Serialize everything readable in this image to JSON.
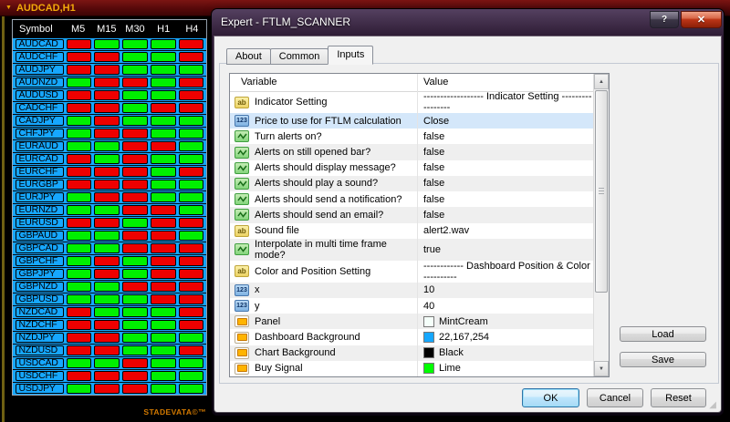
{
  "icons": {
    "dropdown": "▼",
    "help": "?",
    "close": "✕",
    "scroll_up": "▲",
    "scroll_down": "▼",
    "resize_grip": "◢"
  },
  "chart_window": {
    "title": "AUDCAD,H1",
    "watermark": "STADEVATA©™",
    "dashboard": {
      "columns": [
        "Symbol",
        "M5",
        "M15",
        "M30",
        "H1",
        "H4"
      ],
      "panel_color": "#16A7FE",
      "buy_color": "#00F000",
      "sell_color": "#EE0000",
      "rows": [
        {
          "symbol": "AUDCAD",
          "signals": [
            "sell",
            "buy",
            "buy",
            "buy",
            "sell"
          ]
        },
        {
          "symbol": "AUDCHF",
          "signals": [
            "sell",
            "sell",
            "buy",
            "buy",
            "sell"
          ]
        },
        {
          "symbol": "AUDJPY",
          "signals": [
            "sell",
            "sell",
            "buy",
            "buy",
            "buy"
          ]
        },
        {
          "symbol": "AUDNZD",
          "signals": [
            "buy",
            "sell",
            "sell",
            "buy",
            "sell"
          ]
        },
        {
          "symbol": "AUDUSD",
          "signals": [
            "sell",
            "sell",
            "buy",
            "buy",
            "sell"
          ]
        },
        {
          "symbol": "CADCHF",
          "signals": [
            "sell",
            "sell",
            "buy",
            "sell",
            "sell"
          ]
        },
        {
          "symbol": "CADJPY",
          "signals": [
            "buy",
            "sell",
            "buy",
            "buy",
            "buy"
          ]
        },
        {
          "symbol": "CHFJPY",
          "signals": [
            "buy",
            "sell",
            "sell",
            "buy",
            "buy"
          ]
        },
        {
          "symbol": "EURAUD",
          "signals": [
            "buy",
            "buy",
            "sell",
            "sell",
            "buy"
          ]
        },
        {
          "symbol": "EURCAD",
          "signals": [
            "sell",
            "buy",
            "sell",
            "buy",
            "buy"
          ]
        },
        {
          "symbol": "EURCHF",
          "signals": [
            "sell",
            "sell",
            "sell",
            "buy",
            "sell"
          ]
        },
        {
          "symbol": "EURGBP",
          "signals": [
            "sell",
            "sell",
            "sell",
            "buy",
            "buy"
          ]
        },
        {
          "symbol": "EURJPY",
          "signals": [
            "buy",
            "sell",
            "sell",
            "buy",
            "buy"
          ]
        },
        {
          "symbol": "EURNZD",
          "signals": [
            "buy",
            "buy",
            "sell",
            "sell",
            "buy"
          ]
        },
        {
          "symbol": "EURUSD",
          "signals": [
            "sell",
            "sell",
            "buy",
            "sell",
            "sell"
          ]
        },
        {
          "symbol": "GBPAUD",
          "signals": [
            "buy",
            "buy",
            "sell",
            "sell",
            "buy"
          ]
        },
        {
          "symbol": "GBPCAD",
          "signals": [
            "buy",
            "buy",
            "sell",
            "sell",
            "sell"
          ]
        },
        {
          "symbol": "GBPCHF",
          "signals": [
            "buy",
            "sell",
            "buy",
            "sell",
            "sell"
          ]
        },
        {
          "symbol": "GBPJPY",
          "signals": [
            "buy",
            "sell",
            "buy",
            "sell",
            "sell"
          ]
        },
        {
          "symbol": "GBPNZD",
          "signals": [
            "buy",
            "buy",
            "sell",
            "sell",
            "sell"
          ]
        },
        {
          "symbol": "GBPUSD",
          "signals": [
            "buy",
            "buy",
            "buy",
            "sell",
            "sell"
          ]
        },
        {
          "symbol": "NZDCAD",
          "signals": [
            "sell",
            "buy",
            "buy",
            "buy",
            "sell"
          ]
        },
        {
          "symbol": "NZDCHF",
          "signals": [
            "sell",
            "sell",
            "buy",
            "buy",
            "sell"
          ]
        },
        {
          "symbol": "NZDJPY",
          "signals": [
            "sell",
            "sell",
            "buy",
            "buy",
            "buy"
          ]
        },
        {
          "symbol": "NZDUSD",
          "signals": [
            "sell",
            "sell",
            "buy",
            "buy",
            "sell"
          ]
        },
        {
          "symbol": "USDCAD",
          "signals": [
            "buy",
            "buy",
            "sell",
            "buy",
            "buy"
          ]
        },
        {
          "symbol": "USDCHF",
          "signals": [
            "sell",
            "sell",
            "sell",
            "buy",
            "buy"
          ]
        },
        {
          "symbol": "USDJPY",
          "signals": [
            "buy",
            "sell",
            "sell",
            "buy",
            "buy"
          ]
        }
      ]
    }
  },
  "dialog": {
    "title": "Expert - FTLM_SCANNER",
    "tabs": [
      {
        "label": "About",
        "active": false
      },
      {
        "label": "Common",
        "active": false
      },
      {
        "label": "Inputs",
        "active": true
      }
    ],
    "table": {
      "headers": [
        "Variable",
        "Value"
      ],
      "type_labels": {
        "string": "ab",
        "integer": "123",
        "bool": "",
        "color": ""
      },
      "rows": [
        {
          "type": "string",
          "name": "Indicator Setting",
          "value": "------------------ Indicator Setting -----------------"
        },
        {
          "type": "integer",
          "name": "Price to use for FTLM calculation",
          "value": "Close",
          "selected": true
        },
        {
          "type": "bool",
          "name": "Turn alerts on?",
          "value": "false"
        },
        {
          "type": "bool",
          "name": "Alerts on still opened bar?",
          "value": "false"
        },
        {
          "type": "bool",
          "name": "Alerts should display message?",
          "value": "false"
        },
        {
          "type": "bool",
          "name": "Alerts should play a sound?",
          "value": "false"
        },
        {
          "type": "bool",
          "name": "Alerts should send a notification?",
          "value": "false"
        },
        {
          "type": "bool",
          "name": "Alerts should send an email?",
          "value": "false"
        },
        {
          "type": "string",
          "name": "Sound file",
          "value": "alert2.wav"
        },
        {
          "type": "bool",
          "name": "Interpolate in multi time frame mode?",
          "value": "true"
        },
        {
          "type": "string",
          "name": "Color and Position Setting",
          "value": "------------ Dashboard Position & Color ----------"
        },
        {
          "type": "integer",
          "name": "x",
          "value": "10"
        },
        {
          "type": "integer",
          "name": "y",
          "value": "40"
        },
        {
          "type": "color",
          "name": "Panel",
          "value": "MintCream",
          "swatch": "#F5FFFA"
        },
        {
          "type": "color",
          "name": "Dashboard Background",
          "value": "22,167,254",
          "swatch": "#16A7FE"
        },
        {
          "type": "color",
          "name": "Chart Background",
          "value": "Black",
          "swatch": "#000000"
        },
        {
          "type": "color",
          "name": "Buy Signal",
          "value": "Lime",
          "swatch": "#00FF00"
        }
      ]
    },
    "buttons": {
      "load": "Load",
      "save": "Save",
      "ok": "OK",
      "cancel": "Cancel",
      "reset": "Reset"
    }
  }
}
